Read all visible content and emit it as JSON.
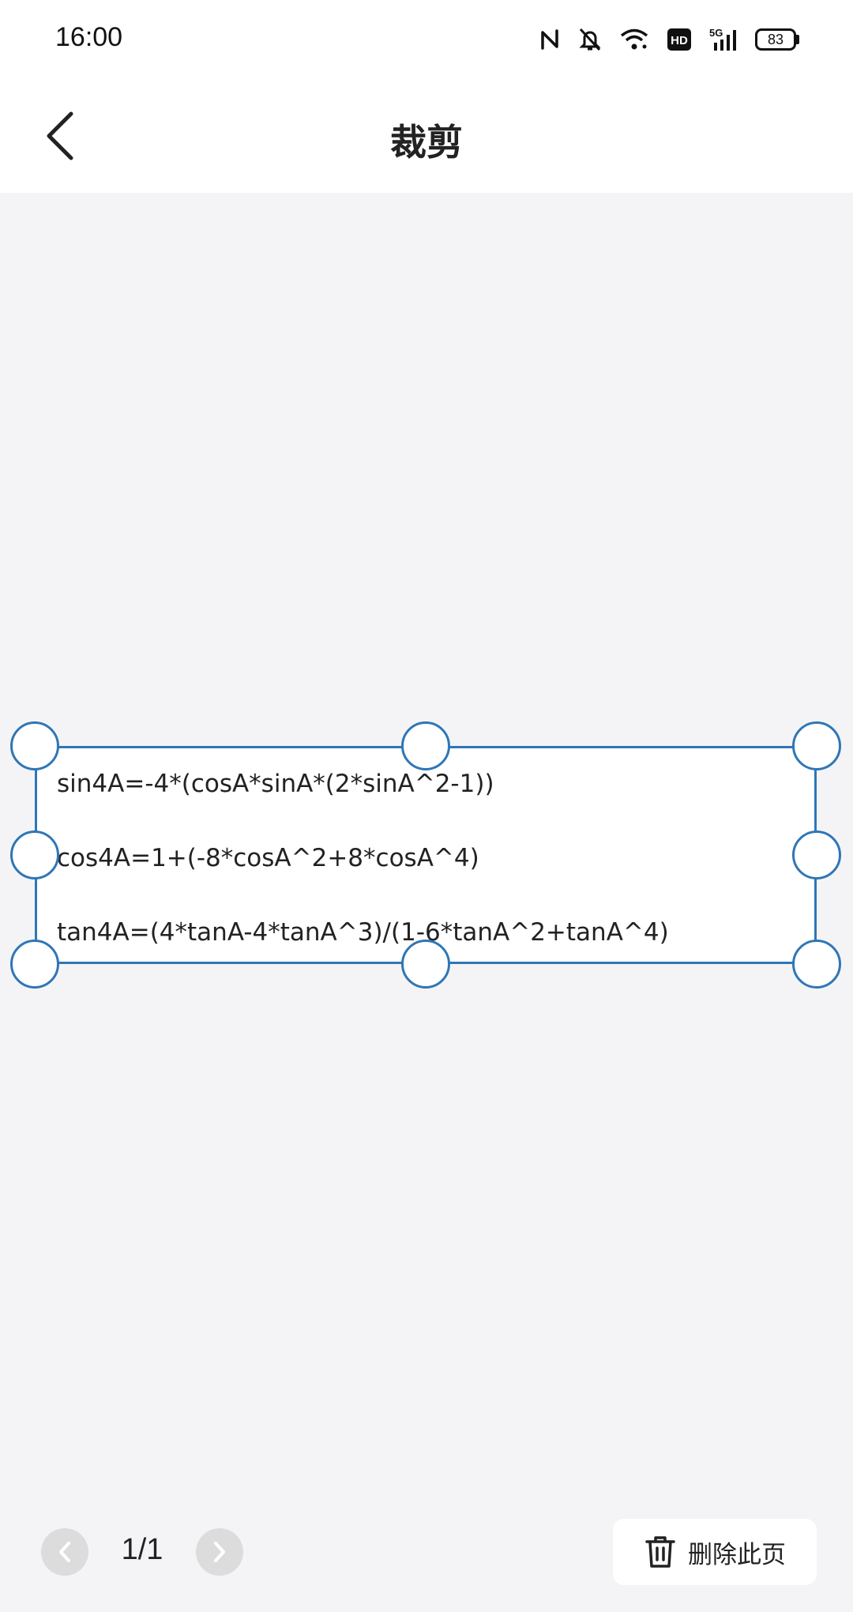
{
  "status_bar": {
    "time": "16:00",
    "battery": "83",
    "network": "5G",
    "hd": "HD",
    "icons": [
      "nfc-icon",
      "bell-muted-icon",
      "wifi-icon",
      "hd-icon",
      "signal-5g-icon",
      "battery-icon"
    ]
  },
  "nav": {
    "title": "裁剪",
    "back_icon": "chevron-left-icon"
  },
  "crop": {
    "formulas": [
      "sin4A=-4*(cosA*sinA*(2*sinA^2-1))",
      "cos4A=1+(-8*cosA^2+8*cosA^4)",
      "tan4A=(4*tanA-4*tanA^3)/(1-6*tanA^2+tanA^4)"
    ],
    "frame_color": "#2f76b6"
  },
  "footer": {
    "page_label": "1/1",
    "delete_label": "删除此页",
    "delete_icon": "trash-icon"
  }
}
